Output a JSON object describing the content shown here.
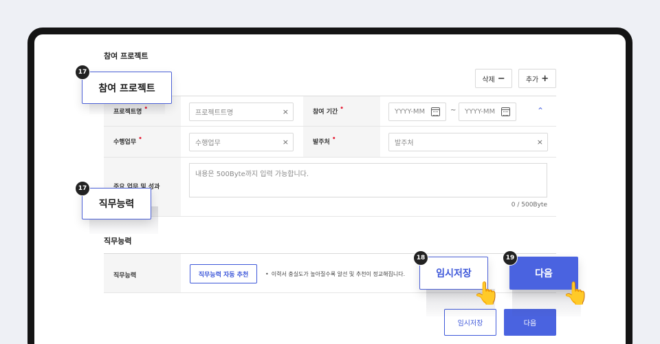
{
  "project_section": {
    "title": "참여 프로젝트",
    "delete_label": "삭제",
    "delete_icon": "−",
    "add_label": "추가",
    "add_icon": "+",
    "project_name_label": "프로젝트명",
    "project_name_placeholder": "프로젝트트명",
    "period_label": "참여 기간",
    "date_start_placeholder": "YYYY-MM",
    "date_end_placeholder": "YYYY-MM",
    "date_separator": "~",
    "task_label": "수행업무",
    "task_placeholder": "수행업무",
    "client_label": "발주처",
    "client_placeholder": "발주처",
    "achievement_label": "주요 업무 및 성과",
    "achievement_placeholder": "내용은 500Byte까지 입력 가능합니다.",
    "byte_counter": "0 / 500Byte",
    "required_mark": "•",
    "clear_icon": "×",
    "collapse_icon": "⌃"
  },
  "competency_section": {
    "title": "직무능력",
    "row_label": "직무능력",
    "auto_recommend_button": "직무능력 자동 추천",
    "bullet": "•",
    "hint_text": "이력서 충실도가 높아질수록 알선 및 추천이 정교해집니다."
  },
  "footer": {
    "temp_save_label": "임시저장",
    "next_label": "다음"
  },
  "annotations": {
    "callout_project": {
      "badge": "17",
      "text": "참여 프로젝트"
    },
    "callout_competency": {
      "badge": "17",
      "text": "직무능력"
    },
    "callout_temp_save": {
      "badge": "18",
      "text": "임시저장"
    },
    "callout_next": {
      "badge": "19",
      "text": "다음"
    },
    "hand_icon": "👆"
  },
  "colors": {
    "accent": "#4a63e0",
    "required": "#e5243b",
    "device_frame": "#141414"
  }
}
